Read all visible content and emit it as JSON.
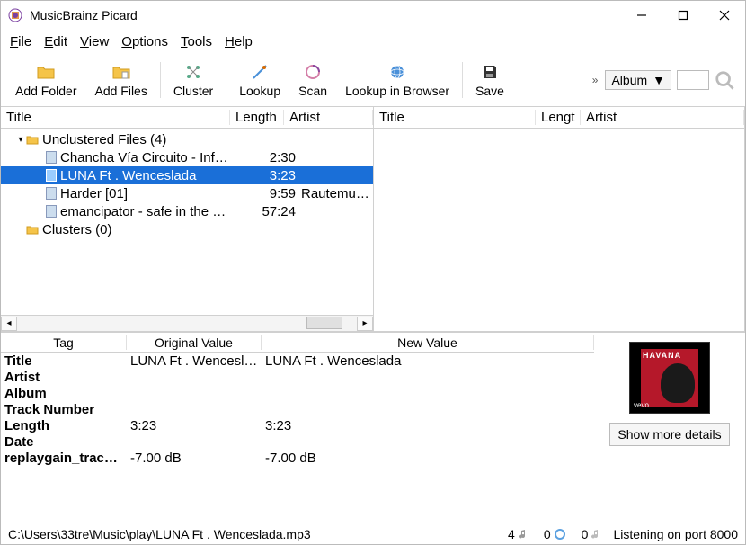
{
  "titlebar": {
    "title": "MusicBrainz Picard"
  },
  "menubar": {
    "file": "File",
    "edit": "Edit",
    "view": "View",
    "options": "Options",
    "tools": "Tools",
    "help": "Help"
  },
  "toolbar": {
    "add_folder": "Add Folder",
    "add_files": "Add Files",
    "cluster": "Cluster",
    "lookup": "Lookup",
    "scan": "Scan",
    "lookup_browser": "Lookup in Browser",
    "save": "Save",
    "overflow": "»",
    "mode_select": "Album"
  },
  "left_pane": {
    "headers": {
      "title": "Title",
      "length": "Length",
      "artist": "Artist"
    },
    "root_unclustered": "Unclustered Files (4)",
    "root_clusters": "Clusters (0)",
    "files": [
      {
        "title": "Chancha Vía Circuito - Inf…",
        "length": "2:30",
        "artist": ""
      },
      {
        "title": "LUNA Ft . Wenceslada",
        "length": "3:23",
        "artist": "",
        "selected": true
      },
      {
        "title": "Harder [01]",
        "length": "9:59",
        "artist": "Rautemusik F"
      },
      {
        "title": "emancipator - safe in the …",
        "length": "57:24",
        "artist": ""
      }
    ]
  },
  "right_pane": {
    "headers": {
      "title": "Title",
      "length": "Lengt",
      "artist": "Artist"
    }
  },
  "tags": {
    "headers": {
      "tag": "Tag",
      "orig": "Original Value",
      "new": "New Value"
    },
    "rows": [
      {
        "tag": "Title",
        "orig": "LUNA Ft . Wencesl…",
        "new": "LUNA Ft . Wenceslada"
      },
      {
        "tag": "Artist",
        "orig": "",
        "new": ""
      },
      {
        "tag": "Album",
        "orig": "",
        "new": ""
      },
      {
        "tag": "Track Number",
        "orig": "",
        "new": ""
      },
      {
        "tag": "Length",
        "orig": "3:23",
        "new": "3:23"
      },
      {
        "tag": "Date",
        "orig": "",
        "new": ""
      },
      {
        "tag": "replaygain_trac…",
        "orig": "-7.00 dB",
        "new": "-7.00 dB"
      }
    ],
    "cover_label": "HAVANA",
    "vevo": "vevo",
    "details_btn": "Show more details"
  },
  "statusbar": {
    "path": "C:\\Users\\33tre\\Music\\play\\LUNA Ft . Wenceslada.mp3",
    "files_count": "4",
    "albums_count": "0",
    "pending_count": "0",
    "listening": "Listening on port 8000"
  }
}
